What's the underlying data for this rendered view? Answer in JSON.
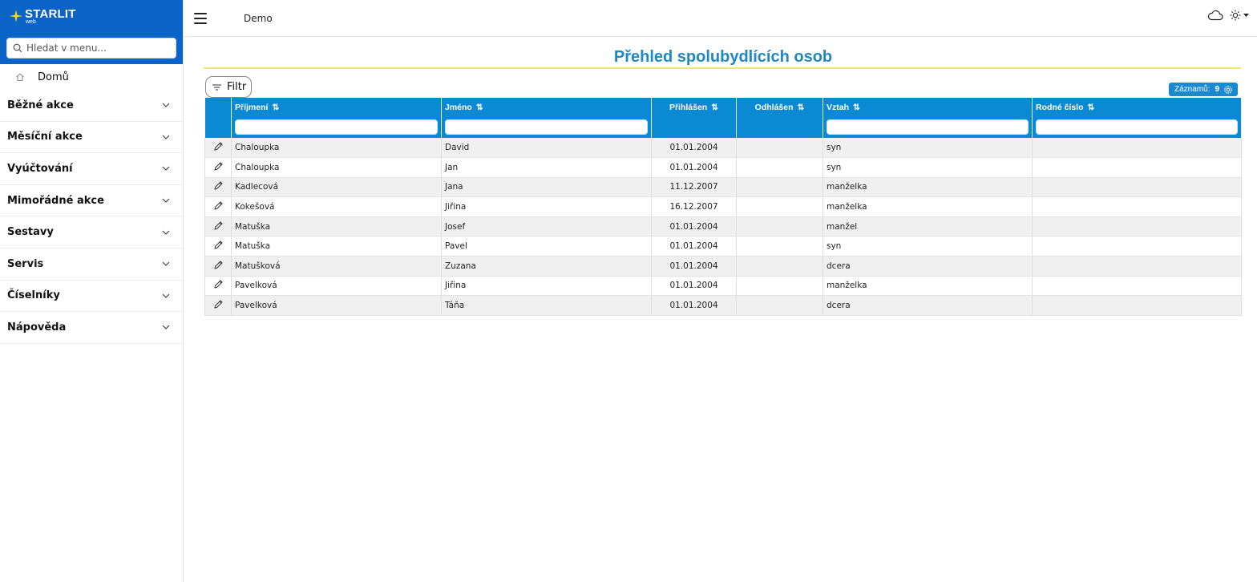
{
  "app": {
    "logo_text": "STARLIT",
    "logo_sub": "web",
    "brand_color": "#0a64c8",
    "accent_color": "#0a8ad3"
  },
  "sidebar": {
    "search_placeholder": "Hledat v menu...",
    "home_label": "Domů",
    "items": [
      {
        "label": "Běžné akce"
      },
      {
        "label": "Měsíční akce"
      },
      {
        "label": "Vyúčtování"
      },
      {
        "label": "Mimořádné akce"
      },
      {
        "label": "Sestavy"
      },
      {
        "label": "Servis"
      },
      {
        "label": "Číselníky"
      },
      {
        "label": "Nápověda"
      }
    ]
  },
  "topbar": {
    "title": "Demo",
    "icons": [
      "menu-icon",
      "cloud-icon",
      "sun-icon"
    ]
  },
  "main": {
    "title": "Přehled spolubydlících osob",
    "filter_label": "Filtr",
    "records_label": "Záznamů:",
    "records_count": "9",
    "columns": [
      "Příjmení",
      "Jméno",
      "Přihlášen",
      "Odhlášen",
      "Vztah",
      "Rodné číslo"
    ],
    "rows": [
      [
        "Chaloupka",
        "David",
        "01.01.2004",
        "",
        "syn",
        ""
      ],
      [
        "Chaloupka",
        "Jan",
        "01.01.2004",
        "",
        "syn",
        ""
      ],
      [
        "Kadlecová",
        "Jana",
        "11.12.2007",
        "",
        "manželka",
        ""
      ],
      [
        "Kokešová",
        "Jiřina",
        "16.12.2007",
        "",
        "manželka",
        ""
      ],
      [
        "Matuška",
        "Josef",
        "01.01.2004",
        "",
        "manžel",
        ""
      ],
      [
        "Matuška",
        "Pavel",
        "01.01.2004",
        "",
        "syn",
        ""
      ],
      [
        "Matušková",
        "Zuzana",
        "01.01.2004",
        "",
        "dcera",
        ""
      ],
      [
        "Pavelková",
        "Jiřina",
        "01.01.2004",
        "",
        "manželka",
        ""
      ],
      [
        "Pavelková",
        "Táňa",
        "01.01.2004",
        "",
        "dcera",
        ""
      ]
    ]
  }
}
